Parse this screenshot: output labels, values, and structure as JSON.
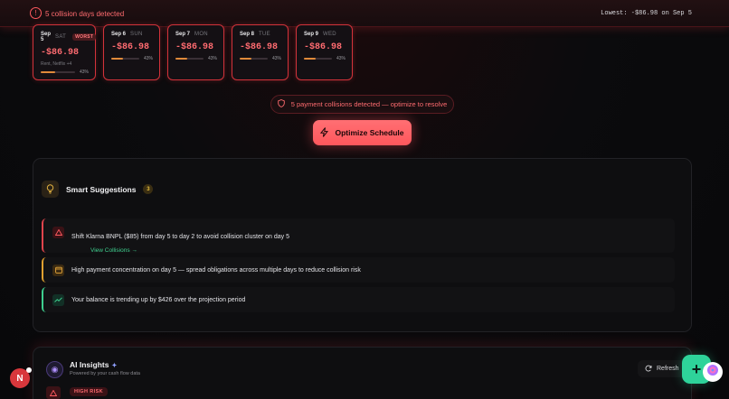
{
  "header": {
    "title": "5 collision days detected",
    "lowest": "Lowest: -$86.98 on Sep 5"
  },
  "days": [
    {
      "date": "Sep 5",
      "weekday": "SAT",
      "badge": "WORST",
      "amount": "-$86.98",
      "bills": "Rent, Netflix +4",
      "pct_label": "43%",
      "progress": 0.43
    },
    {
      "date": "Sep 6",
      "weekday": "SUN",
      "amount": "-$86.98",
      "pct_label": "43%",
      "progress": 0.43
    },
    {
      "date": "Sep 7",
      "weekday": "MON",
      "amount": "-$86.98",
      "pct_label": "43%",
      "progress": 0.43
    },
    {
      "date": "Sep 8",
      "weekday": "TUE",
      "amount": "-$86.98",
      "pct_label": "43%",
      "progress": 0.43
    },
    {
      "date": "Sep 9",
      "weekday": "WED",
      "amount": "-$86.98",
      "pct_label": "43%",
      "progress": 0.43
    }
  ],
  "collision_pill": "5 payment collisions detected — optimize to resolve",
  "optimize_button": "Optimize Schedule",
  "suggestions": {
    "title": "Smart Suggestions",
    "count": "3",
    "items": [
      {
        "text": "Shift Klarna BNPL ($85) from day 5 to day 2 to avoid collision cluster on day 5",
        "link": "View Collisions →",
        "icon": "warning-icon"
      },
      {
        "text": "High payment concentration on day 5 — spread obligations across multiple days to reduce collision risk",
        "icon": "calendar-icon"
      },
      {
        "text": "Your balance is trending up by $426 over the projection period",
        "icon": "trending-up-icon"
      }
    ]
  },
  "ai_insights": {
    "title": "AI Insights",
    "subtitle": "Powered by your cash flow data",
    "refresh": "Refresh",
    "risk_badge": "HIGH RISK"
  },
  "avatar_initial": "N",
  "colors": {
    "accent_red": "#ff5a5f",
    "accent_green": "#2ed39a",
    "accent_amber": "#e8a83a"
  }
}
